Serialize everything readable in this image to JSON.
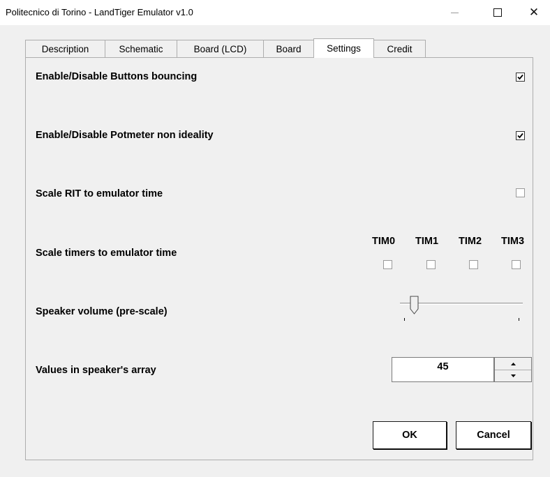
{
  "window": {
    "title": "Politecnico di Torino - LandTiger Emulator v1.0"
  },
  "tabs": [
    {
      "label": "Description",
      "active": false
    },
    {
      "label": "Schematic",
      "active": false
    },
    {
      "label": "Board (LCD)",
      "active": false
    },
    {
      "label": "Board",
      "active": false
    },
    {
      "label": "Settings",
      "active": true
    },
    {
      "label": "Credit",
      "active": false
    }
  ],
  "settings": {
    "buttons_bouncing": {
      "label": "Enable/Disable Buttons bouncing",
      "checked": true
    },
    "potmeter": {
      "label": "Enable/Disable Potmeter non ideality",
      "checked": true
    },
    "scale_rit": {
      "label": "Scale RIT to emulator time",
      "checked": false
    },
    "scale_timers": {
      "label": "Scale timers to emulator time",
      "timers": [
        {
          "label": "TIM0",
          "checked": false
        },
        {
          "label": "TIM1",
          "checked": false
        },
        {
          "label": "TIM2",
          "checked": false
        },
        {
          "label": "TIM3",
          "checked": false
        }
      ]
    },
    "speaker_volume": {
      "label": "Speaker volume (pre-scale)",
      "level": 0.1
    },
    "speaker_array": {
      "label": "Values in speaker's array",
      "value": "45"
    }
  },
  "buttons": {
    "ok": "OK",
    "cancel": "Cancel"
  },
  "icons": {
    "minimize": "minimize-icon",
    "maximize": "maximize-icon",
    "close": "close-icon",
    "check": "check-icon",
    "spin_up": "caret-up-icon",
    "spin_down": "caret-down-icon"
  }
}
